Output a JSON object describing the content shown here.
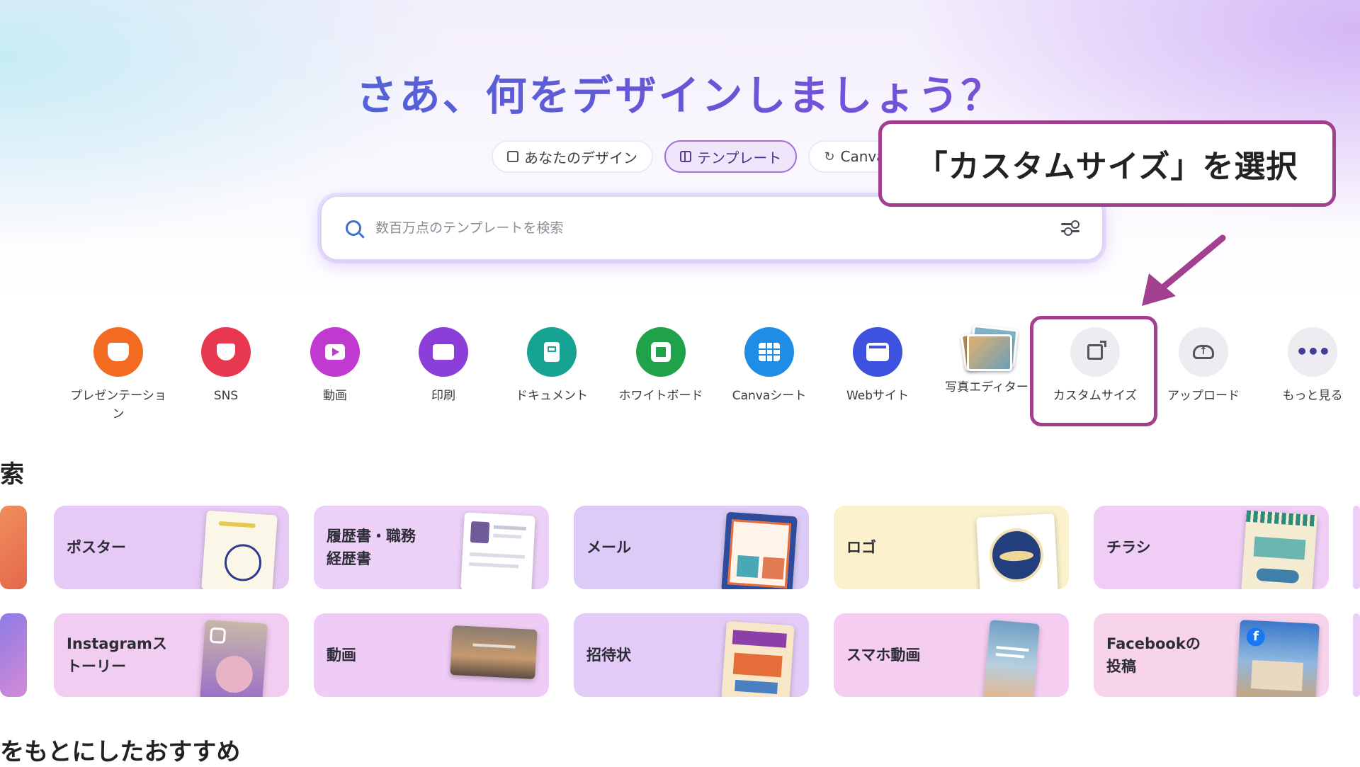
{
  "hero": {
    "title": "さあ、何をデザインしましょう？"
  },
  "scope_tabs": [
    {
      "label": "あなたのデザイン",
      "active": false,
      "icon": "folder-icon"
    },
    {
      "label": "テンプレート",
      "active": true,
      "icon": "template-icon"
    },
    {
      "label": "Canva",
      "active": false,
      "icon": "canva-ai-icon"
    }
  ],
  "search": {
    "placeholder": "数百万点のテンプレートを検索",
    "value": ""
  },
  "callout": {
    "text": "「カスタムサイズ」を選択",
    "color": "#a23f8f"
  },
  "categories": [
    {
      "label": "プレゼンテーション",
      "icon": "presentation-icon",
      "color": "#f36b21"
    },
    {
      "label": "SNS",
      "icon": "heart-icon",
      "color": "#e8384f"
    },
    {
      "label": "動画",
      "icon": "video-icon",
      "color": "#c039d0"
    },
    {
      "label": "印刷",
      "icon": "printer-icon",
      "color": "#8b3fd8"
    },
    {
      "label": "ドキュメント",
      "icon": "document-icon",
      "color": "#17a394"
    },
    {
      "label": "ホワイトボード",
      "icon": "whiteboard-icon",
      "color": "#1fa24a"
    },
    {
      "label": "Canvaシート",
      "icon": "sheet-icon",
      "color": "#1f8de6"
    },
    {
      "label": "Webサイト",
      "icon": "website-icon",
      "color": "#3d53e0"
    },
    {
      "label": "写真エディター",
      "icon": "photo-editor-icon",
      "color": "#c49257"
    },
    {
      "label": "カスタムサイズ",
      "icon": "custom-size-icon",
      "color": "#ececf1"
    },
    {
      "label": "アップロード",
      "icon": "upload-icon",
      "color": "#ececf1"
    },
    {
      "label": "もっと見る",
      "icon": "more-icon",
      "color": "#ececf1"
    }
  ],
  "sections": {
    "explore_partial": "索",
    "recommended_partial": "をもとにしたおすすめ"
  },
  "template_cards_row1": [
    {
      "label": "ポスター",
      "bg": "#e7c9f5"
    },
    {
      "label": "履歴書・職務経歴書",
      "bg": "#ecd0f7"
    },
    {
      "label": "メール",
      "bg": "#dccbf6"
    },
    {
      "label": "ロゴ",
      "bg": "#fbf1cc"
    },
    {
      "label": "チラシ",
      "bg": "#efcdf5"
    }
  ],
  "template_cards_row2": [
    {
      "label": "Instagramストーリー",
      "bg": "#f2cdf2"
    },
    {
      "label": "動画",
      "bg": "#efccf6"
    },
    {
      "label": "招待状",
      "bg": "#e2ccf7"
    },
    {
      "label": "スマホ動画",
      "bg": "#f4cdf1"
    },
    {
      "label": "Facebookの投稿",
      "bg": "#f8d3ec"
    }
  ]
}
